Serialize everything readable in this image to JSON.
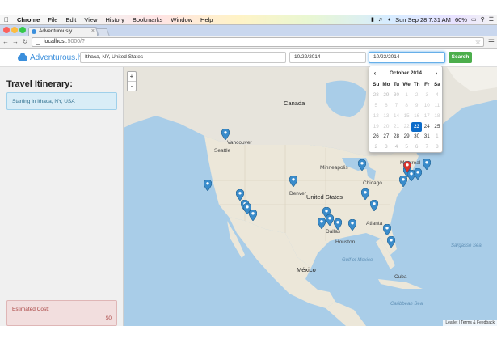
{
  "menubar": {
    "apple": "",
    "app": "Chrome",
    "items": [
      "File",
      "Edit",
      "View",
      "History",
      "Bookmarks",
      "Window",
      "Help"
    ],
    "datetime": "Sun Sep 28  7:31 AM",
    "battery": "60%"
  },
  "browser": {
    "tab_title": "Adventurously",
    "url_host": "localhost",
    "url_rest": ":5000/?"
  },
  "app": {
    "brand": "Adventurous.ly",
    "origin_value": "Ithaca, NY, United States",
    "depart_value": "10/22/2014",
    "return_value": "10/23/2014",
    "search_label": "Search"
  },
  "sidebar": {
    "title": "Travel Itinerary:",
    "start_text": "Starting in Ithaca, NY, USA",
    "cost_label": "Estimated Cost:",
    "cost_value": "$0"
  },
  "map": {
    "zoom_in": "+",
    "zoom_out": "-",
    "labels": {
      "canada": "Canada",
      "united_states": "United States",
      "mexico": "México",
      "montreal": "Montreal",
      "minneapolis": "Minneapolis",
      "chicago": "Chicago",
      "denver": "Denver",
      "dallas": "Dallas",
      "houston": "Houston",
      "atlanta": "Atlanta",
      "seattle": "Seattle",
      "vancouver": "Vancouver",
      "gulf": "Gulf of Mexico",
      "sargasso": "Sargasso Sea",
      "caribbean": "Caribbean Sea",
      "cuba": "Cuba"
    },
    "attribution": "Leaflet | Terms & Feedback"
  },
  "datepicker": {
    "month": "October 2014",
    "prev": "‹",
    "next": "›",
    "dow": [
      "Su",
      "Mo",
      "Tu",
      "We",
      "Th",
      "Fr",
      "Sa"
    ],
    "weeks": [
      [
        "28",
        "29",
        "30",
        "1",
        "2",
        "3",
        "4"
      ],
      [
        "5",
        "6",
        "7",
        "8",
        "9",
        "10",
        "11"
      ],
      [
        "12",
        "13",
        "14",
        "15",
        "16",
        "17",
        "18"
      ],
      [
        "19",
        "20",
        "21",
        "22",
        "23",
        "24",
        "25"
      ],
      [
        "26",
        "27",
        "28",
        "29",
        "30",
        "31",
        "1"
      ],
      [
        "2",
        "3",
        "4",
        "5",
        "6",
        "7",
        "8"
      ]
    ],
    "selected": "23"
  },
  "colors": {
    "brand": "#3b8fdc",
    "marker": "#3a8ccb",
    "marker_active": "#d9342b",
    "search_button": "#4cae4c",
    "selected_day": "#0b6bc9"
  }
}
